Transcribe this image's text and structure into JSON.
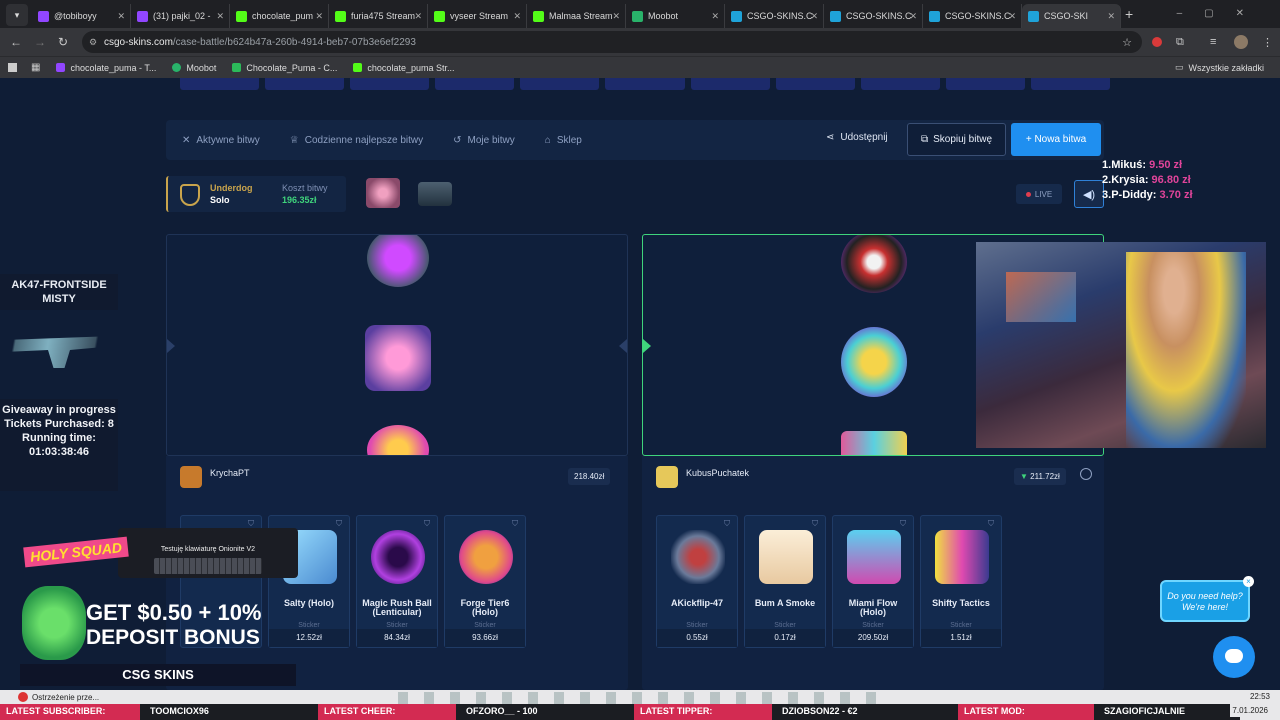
{
  "browser": {
    "tabs": [
      {
        "label": "@tobiboyy",
        "color": "#9146ff"
      },
      {
        "label": "(31) pajki_02 -",
        "color": "#9146ff"
      },
      {
        "label": "chocolate_pum",
        "color": "#53fc18"
      },
      {
        "label": "furia475 Stream",
        "color": "#53fc18"
      },
      {
        "label": "vyseer Stream",
        "color": "#53fc18"
      },
      {
        "label": "Malmaa Stream",
        "color": "#53fc18"
      },
      {
        "label": "Moobot",
        "color": "#29b36a"
      },
      {
        "label": "CSGO-SKINS.C",
        "color": "#1fa3d9"
      },
      {
        "label": "CSGO-SKINS.C",
        "color": "#1fa3d9"
      },
      {
        "label": "CSGO-SKINS.C",
        "color": "#1fa3d9"
      },
      {
        "label": "CSGO-SKI",
        "color": "#1fa3d9"
      }
    ],
    "url_host": "csgo-skins.com",
    "url_path": "/case-battle/b624b47a-260b-4914-beb7-07b3e6ef2293",
    "bookmarks": [
      "chocolate_puma - T...",
      "Moobot",
      "Chocolate_Puma - C...",
      "chocolate_puma Str..."
    ],
    "all_bookmarks": "Wszystkie zakładki"
  },
  "nav": {
    "active_battles": "Aktywne bitwy",
    "daily_best": "Codzienne najlepsze bitwy",
    "my_battles": "Moje bitwy",
    "shop": "Sklep",
    "share": "Udostępnij",
    "copy_battle": "Skopiuj bitwę",
    "new_battle": "+ Nowa bitwa"
  },
  "battle": {
    "mode": "Underdog",
    "type": "Solo",
    "cost_label": "Koszt bitwy",
    "cost": "196.35zł",
    "live": "LIVE"
  },
  "players": [
    {
      "name": "KrychaPT",
      "total": "218.40zł",
      "items": [
        {
          "name": "Salty (Holo)",
          "type": "Sticker",
          "price": "12.52zł"
        },
        {
          "name": "Magic Rush Ball (Lenticular)",
          "type": "Sticker",
          "price": "84.34zł"
        },
        {
          "name": "Forge Tier6 (Holo)",
          "type": "Sticker",
          "price": "93.66zł"
        }
      ]
    },
    {
      "name": "KubusPuchatek",
      "total": "211.72zł",
      "items": [
        {
          "name": "AKickflip-47",
          "type": "Sticker",
          "price": "0.55zł"
        },
        {
          "name": "Bum A Smoke",
          "type": "Sticker",
          "price": "0.17zł"
        },
        {
          "name": "Miami Flow (Holo)",
          "type": "Sticker",
          "price": "209.50zł"
        },
        {
          "name": "Shifty Tactics",
          "type": "Sticker",
          "price": "1.51zł"
        }
      ]
    }
  ],
  "overlay": {
    "skin_title": "AK47-FRONTSIDE MISTY",
    "giveaway_1": "Giveaway in progress",
    "tickets": "Tickets Purchased: 8",
    "running": "Running time: 01:03:38:46",
    "leaderboard": [
      {
        "rank": "1.",
        "name": "Mikuś:",
        "amount": "9.50 zł"
      },
      {
        "rank": "2.",
        "name": "Krysia:",
        "amount": "96.80 zł"
      },
      {
        "rank": "3.",
        "name": "P-Diddy:",
        "amount": "3.70 zł"
      }
    ],
    "keyboard_title": "Testuję klawiaturę Onionite V2",
    "promo_squad": "HOLY SQUAD",
    "promo_line1": "GET $0.50 + 10%",
    "promo_line2": "DEPOSIT BONUS",
    "promo_brand": "CSG SKINS",
    "help": "Do you need help? We're here!"
  },
  "taskbar": {
    "warning": "Ostrzeżenie prze...",
    "time": "22:53",
    "date": "7.01.2026"
  },
  "ticker": [
    {
      "label": "LATEST SUBSCRIBER:",
      "value": "TOOMCIOX96"
    },
    {
      "label": "LATEST CHEER:",
      "value": "OFZORO__ - 100"
    },
    {
      "label": "LATEST TIPPER:",
      "value": "DZIOBSON22 - €2"
    },
    {
      "label": "LATEST MOD:",
      "value": "SZAGIOFICJALNIE"
    }
  ]
}
